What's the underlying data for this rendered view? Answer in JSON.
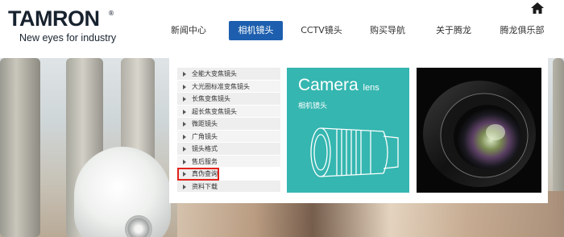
{
  "brand": {
    "logo_text": "TAMRON",
    "registered_mark": "®",
    "tagline": "New eyes for industry"
  },
  "header": {
    "home_icon": "home-icon"
  },
  "nav": {
    "items": [
      {
        "label": "新闻中心",
        "active": false
      },
      {
        "label": "相机镜头",
        "active": true
      },
      {
        "label": "CCTV镜头",
        "active": false
      },
      {
        "label": "购买导航",
        "active": false
      },
      {
        "label": "关于腾龙",
        "active": false
      },
      {
        "label": "腾龙俱乐部",
        "active": false
      }
    ],
    "active_color": "#1d5fae"
  },
  "dropdown": {
    "menu": [
      {
        "label": "全能大变焦镜头"
      },
      {
        "label": "大光圈标准变焦镜头"
      },
      {
        "label": "长焦变焦镜头"
      },
      {
        "label": "超长焦变焦镜头"
      },
      {
        "label": "微距镜头"
      },
      {
        "label": "广角镜头"
      },
      {
        "label": "镜头格式"
      },
      {
        "label": "售后服务"
      },
      {
        "label": "真伪查询",
        "highlighted": true
      },
      {
        "label": "资料下载"
      }
    ],
    "highlight_color": "#e2231a",
    "camera_card": {
      "title": "Camera",
      "title_suffix": "lens",
      "subtitle": "相机镜头",
      "background": "#35b6b0"
    }
  }
}
